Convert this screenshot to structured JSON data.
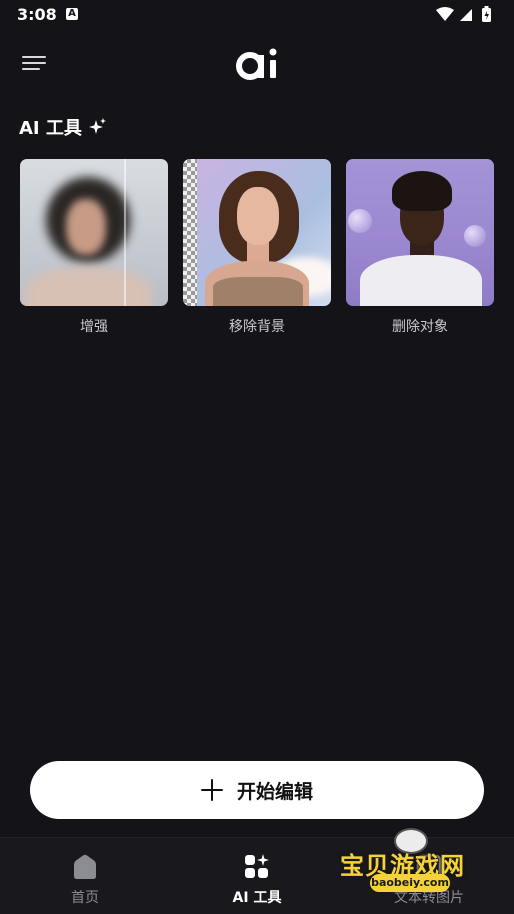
{
  "status_bar": {
    "time": "3:08",
    "notification_icon": "A"
  },
  "header": {
    "menu_icon": "hamburger-menu-icon",
    "logo_icon": "ai-logo-icon"
  },
  "section": {
    "title": "AI 工具",
    "icon": "sparkle-icon"
  },
  "tools": [
    {
      "label": "增强"
    },
    {
      "label": "移除背景"
    },
    {
      "label": "删除对象"
    }
  ],
  "start_button": {
    "label": "开始编辑"
  },
  "bottom_nav": {
    "items": [
      {
        "label": "首页",
        "icon": "home-icon",
        "active": false
      },
      {
        "label": "AI 工具",
        "icon": "ai-tools-icon",
        "active": true
      },
      {
        "label": "文本转图片",
        "icon": "text-to-image-icon",
        "active": false
      }
    ]
  },
  "watermark": {
    "text": "宝贝游戏网",
    "sub": "baobeiy.com"
  },
  "colors": {
    "background": "#131318",
    "button_bg": "#ffffff",
    "nav_bg": "#18181d",
    "watermark": "#f5d237"
  }
}
